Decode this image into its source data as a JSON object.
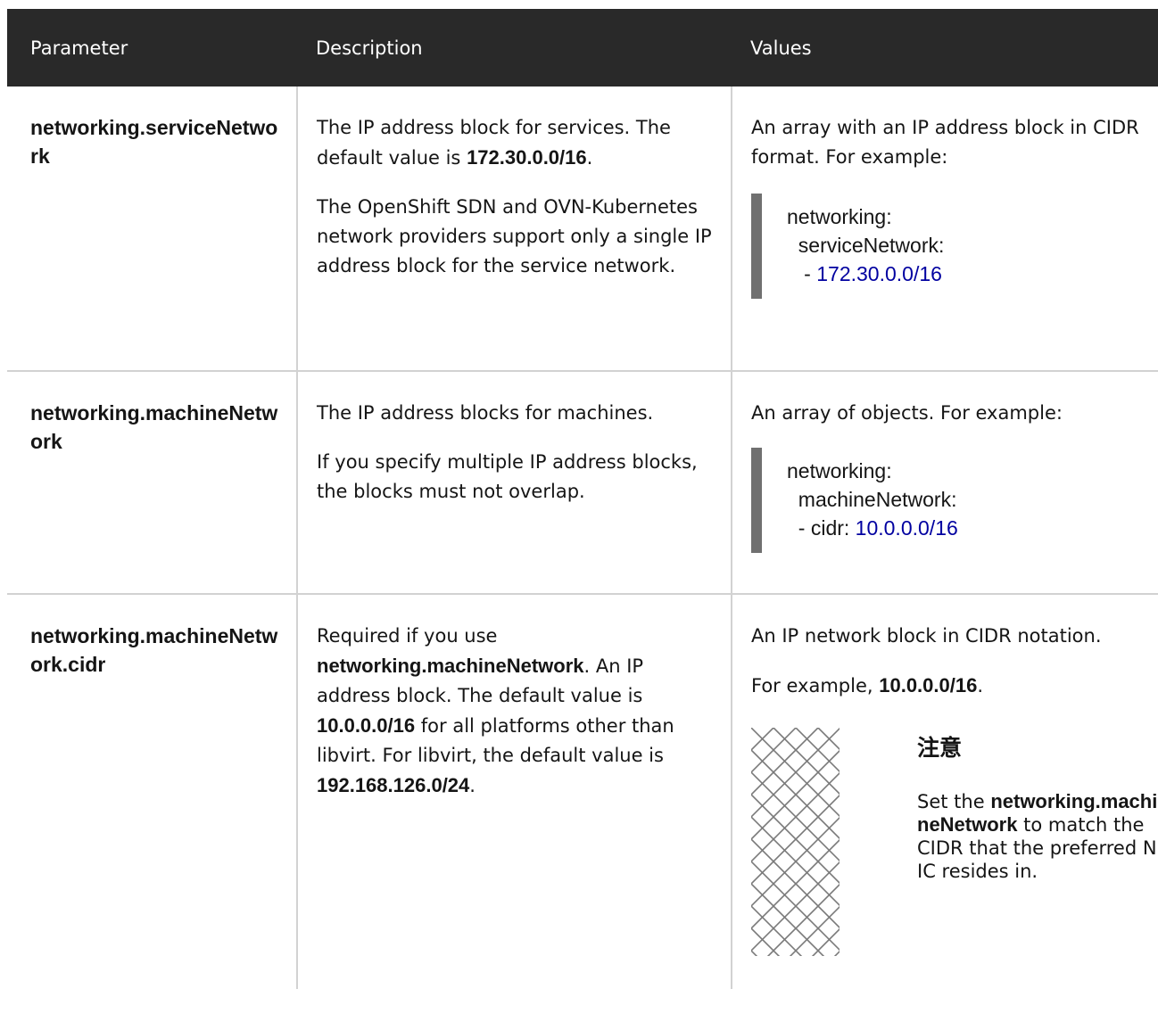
{
  "table": {
    "headers": [
      "Parameter",
      "Description",
      "Values"
    ],
    "rows": [
      {
        "param": "networking.serviceNetwork",
        "desc_p1_a": "The IP address block for services. The default value is ",
        "desc_p1_b": "172.30.0.0/16",
        "desc_p1_c": ".",
        "desc_p2": "The OpenShift SDN and OVN-Kubernetes network providers support only a single IP address block for the service network.",
        "value_text": "An array with an IP address block in CIDR format. For example:",
        "code_l1": "networking:",
        "code_l2": "  serviceNetwork:",
        "code_l3_prefix": "   - ",
        "code_l3_value": "172.30.0.0/16"
      },
      {
        "param": "networking.machineNetwork",
        "desc_p1": "The IP address blocks for machines.",
        "desc_p2": "If you specify multiple IP address blocks, the blocks must not overlap.",
        "value_text": "An array of objects. For example:",
        "code_l1": "networking:",
        "code_l2": "  machineNetwork:",
        "code_l3_prefix": "  - cidr: ",
        "code_l3_value": "10.0.0.0/16"
      },
      {
        "param": "networking.machineNetwork.cidr",
        "desc_a": "Required if you use ",
        "desc_b": "networking.machineNetwork",
        "desc_c": ". An IP address block. The default value is ",
        "desc_d": "10.0.0.0/16",
        "desc_e": " for all platforms other than libvirt. For libvirt, the default value is ",
        "desc_f": "192.168.126.0/24",
        "desc_g": ".",
        "value_p1": "An IP network block in CIDR notation.",
        "value_p2_a": "For example, ",
        "value_p2_b": "10.0.0.0/16",
        "value_p2_c": ".",
        "note_title": "注意",
        "note_a": "Set the ",
        "note_b": "networking.machineNetwork",
        "note_c": " to match the CIDR that the preferred NIC resides in."
      }
    ]
  },
  "colors": {
    "header_bg": "#292929",
    "code_number": "#0000a0",
    "code_border": "#707070",
    "divider": "#d2d2d2"
  },
  "icons": {
    "note": "crosshatch-pattern-icon"
  }
}
